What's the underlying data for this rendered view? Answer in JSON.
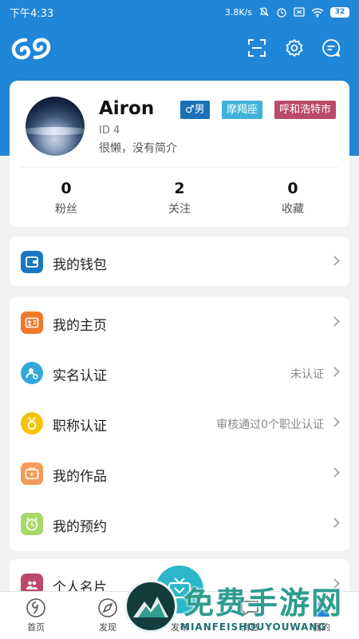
{
  "status_bar": {
    "time": "下午4:33",
    "speed": "3.8K/s",
    "battery": "32"
  },
  "profile": {
    "name": "Airon",
    "id": "ID 4",
    "bio": "很懒，没有简介",
    "tags": {
      "gender": "♂男",
      "zodiac": "摩羯座",
      "city": "呼和浩特市"
    },
    "stats": {
      "fans": {
        "value": "0",
        "label": "粉丝"
      },
      "following": {
        "value": "2",
        "label": "关注"
      },
      "favorites": {
        "value": "0",
        "label": "收藏"
      }
    }
  },
  "menu": {
    "wallet": {
      "label": "我的钱包"
    },
    "homepage": {
      "label": "我的主页"
    },
    "realname": {
      "label": "实名认证",
      "value": "未认证"
    },
    "title_cert": {
      "label": "职称认证",
      "value": "审核通过0个职业认证"
    },
    "works": {
      "label": "我的作品"
    },
    "booking": {
      "label": "我的预约"
    },
    "namecard": {
      "label": "个人名片"
    }
  },
  "bottom_nav": {
    "home": "首页",
    "discover": "发现",
    "publish": "发布",
    "chat": "消息",
    "me": "我的"
  },
  "watermark": {
    "text": "免费手游网",
    "sub": "MIANFEISHOUYOUWANG"
  },
  "colors": {
    "primary": "#1f86d8",
    "wallet_icon": "#1b77c4",
    "homepage_icon": "#f07a2b",
    "realname_icon": "#34a7d9",
    "title_icon": "#f5c300",
    "works_icon": "#f59b5a",
    "booking_icon": "#a7d868",
    "namecard_icon": "#b94a6a"
  }
}
